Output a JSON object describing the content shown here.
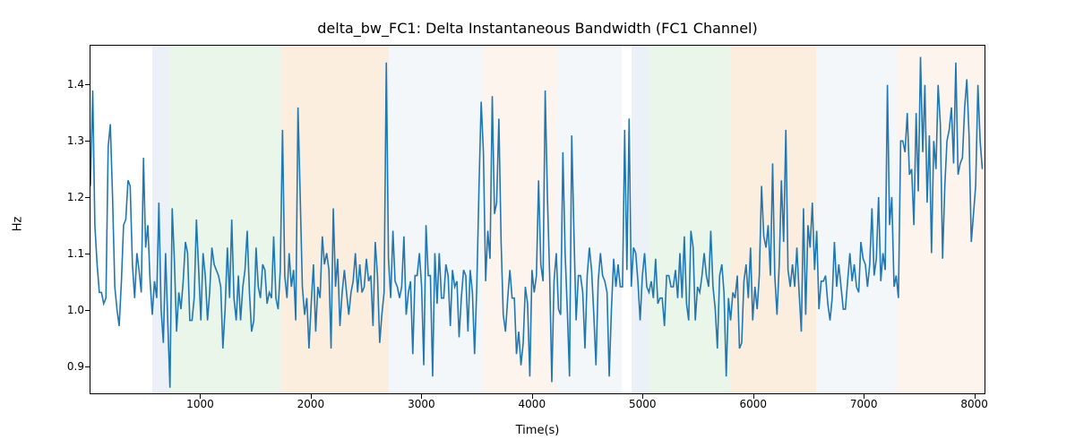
{
  "chart_data": {
    "type": "line",
    "title": "delta_bw_FC1: Delta Instantaneous Bandwidth (FC1 Channel)",
    "xlabel": "Time(s)",
    "ylabel": "Hz",
    "xlim": [
      0,
      8100
    ],
    "ylim": [
      0.85,
      1.47
    ],
    "xticks": [
      1000,
      2000,
      3000,
      4000,
      5000,
      6000,
      7000,
      8000
    ],
    "yticks": [
      0.9,
      1.0,
      1.1,
      1.2,
      1.3,
      1.4
    ],
    "line_color": "#1f77b4",
    "bands": [
      {
        "x0": 560,
        "x1": 720,
        "color": "blue"
      },
      {
        "x0": 720,
        "x1": 1720,
        "color": "green"
      },
      {
        "x0": 1720,
        "x1": 2700,
        "color": "orange"
      },
      {
        "x0": 2700,
        "x1": 3550,
        "color": "lblue"
      },
      {
        "x0": 3550,
        "x1": 4220,
        "color": "lorange"
      },
      {
        "x0": 4220,
        "x1": 4800,
        "color": "lblue"
      },
      {
        "x0": 4890,
        "x1": 5050,
        "color": "blue"
      },
      {
        "x0": 5050,
        "x1": 5780,
        "color": "green"
      },
      {
        "x0": 5780,
        "x1": 6560,
        "color": "orange"
      },
      {
        "x0": 6560,
        "x1": 7290,
        "color": "lblue"
      },
      {
        "x0": 7290,
        "x1": 8100,
        "color": "lorange"
      }
    ],
    "series": [
      {
        "name": "delta_bw_FC1",
        "x_step": 20,
        "values": [
          1.22,
          1.39,
          1.15,
          1.08,
          1.03,
          1.03,
          1.01,
          1.02,
          1.29,
          1.33,
          1.2,
          1.04,
          1.0,
          0.97,
          1.05,
          1.15,
          1.16,
          1.23,
          1.22,
          1.08,
          1.02,
          1.1,
          1.07,
          1.03,
          1.27,
          1.11,
          1.15,
          1.05,
          0.99,
          1.05,
          1.02,
          1.19,
          1.0,
          0.94,
          1.1,
          0.98,
          0.86,
          1.18,
          1.09,
          0.96,
          1.03,
          1.0,
          1.05,
          1.12,
          1.1,
          0.98,
          0.98,
          1.02,
          1.16,
          1.07,
          0.98,
          1.1,
          1.06,
          0.98,
          1.03,
          1.11,
          1.08,
          1.07,
          1.06,
          1.04,
          0.93,
          1.0,
          1.11,
          1.02,
          1.16,
          1.02,
          0.98,
          1.06,
          0.98,
          1.04,
          1.07,
          1.14,
          1.03,
          0.96,
          0.98,
          1.11,
          1.04,
          1.02,
          1.08,
          1.07,
          1.01,
          1.03,
          1.02,
          1.13,
          1.02,
          1.0,
          1.07,
          1.32,
          1.06,
          1.02,
          1.1,
          1.04,
          1.07,
          0.98,
          1.36,
          1.2,
          1.04,
          0.99,
          1.02,
          0.93,
          1.01,
          1.08,
          0.96,
          1.04,
          1.02,
          1.13,
          1.08,
          1.1,
          1.07,
          0.93,
          1.18,
          1.04,
          1.09,
          0.97,
          1.03,
          1.07,
          1.03,
          0.99,
          1.03,
          1.05,
          1.1,
          1.03,
          1.08,
          1.03,
          1.04,
          1.09,
          1.05,
          1.06,
          0.97,
          1.12,
          1.06,
          0.94,
          0.99,
          1.03,
          1.44,
          1.09,
          1.02,
          1.14,
          1.05,
          1.04,
          1.02,
          1.04,
          1.13,
          0.99,
          1.03,
          1.05,
          0.92,
          1.06,
          1.06,
          1.1,
          1.04,
          0.9,
          1.15,
          1.06,
          1.06,
          0.88,
          1.1,
          1.01,
          1.1,
          1.02,
          1.02,
          1.08,
          1.06,
          0.97,
          1.07,
          1.04,
          1.05,
          0.95,
          1.02,
          1.07,
          1.06,
          0.96,
          1.07,
          1.03,
          0.92,
          1.04,
          1.22,
          1.37,
          1.28,
          1.05,
          1.14,
          1.09,
          1.38,
          1.17,
          1.19,
          1.34,
          1.12,
          0.99,
          0.96,
          1.02,
          1.07,
          1.02,
          1.02,
          0.92,
          0.96,
          0.9,
          0.94,
          1.04,
          1.01,
          0.88,
          1.07,
          1.03,
          1.06,
          1.23,
          1.08,
          1.05,
          1.39,
          1.2,
          1.06,
          0.87,
          1.05,
          1.1,
          1.0,
          0.99,
          1.28,
          1.1,
          1.0,
          0.88,
          1.31,
          1.14,
          0.98,
          1.06,
          1.06,
          1.03,
          0.93,
          1.06,
          1.11,
          1.07,
          0.99,
          0.9,
          1.05,
          1.1,
          1.06,
          1.05,
          1.03,
          0.88,
          1.0,
          1.09,
          1.04,
          1.08,
          1.04,
          1.04,
          1.32,
          1.07,
          1.34,
          1.04,
          1.11,
          1.1,
          1.05,
          0.98,
          1.06,
          1.1,
          1.04,
          1.03,
          1.05,
          1.02,
          1.09,
          1.01,
          1.02,
          1.02,
          0.97,
          1.06,
          1.06,
          1.04,
          1.04,
          1.07,
          1.02,
          1.1,
          1.02,
          1.13,
          1.01,
          0.98,
          1.14,
          1.11,
          0.98,
          1.04,
          1.03,
          1.06,
          1.1,
          1.06,
          1.04,
          1.14,
          1.04,
          1.0,
          0.93,
          1.06,
          1.08,
          1.03,
          0.88,
          1.02,
          0.98,
          1.03,
          1.02,
          1.06,
          0.93,
          0.94,
          1.05,
          1.08,
          1.02,
          1.11,
          0.98,
          1.04,
          1.0,
          1.06,
          1.22,
          1.13,
          1.11,
          1.15,
          1.06,
          1.26,
          1.06,
          0.99,
          1.08,
          1.23,
          1.12,
          1.32,
          1.07,
          1.04,
          1.08,
          1.04,
          1.11,
          1.03,
          0.96,
          1.18,
          0.99,
          1.15,
          1.11,
          1.19,
          1.07,
          1.14,
          1.0,
          1.05,
          1.05,
          1.06,
          1.01,
          0.98,
          1.02,
          1.12,
          1.04,
          1.08,
          1.04,
          1.0,
          1.0,
          1.05,
          1.1,
          1.05,
          1.08,
          1.04,
          1.03,
          1.12,
          1.09,
          1.08,
          1.04,
          1.08,
          1.18,
          1.06,
          1.09,
          1.2,
          1.05,
          1.1,
          1.07,
          1.4,
          1.15,
          1.2,
          1.04,
          1.06,
          1.02,
          1.3,
          1.3,
          1.28,
          1.35,
          1.24,
          1.25,
          1.15,
          1.35,
          1.21,
          1.45,
          1.28,
          1.4,
          1.19,
          1.31,
          1.1,
          1.3,
          1.25,
          1.4,
          1.33,
          1.09,
          1.22,
          1.3,
          1.32,
          1.36,
          1.26,
          1.44,
          1.24,
          1.26,
          1.27,
          1.36,
          1.41,
          1.31,
          1.12,
          1.17,
          1.22,
          1.4,
          1.3,
          1.25
        ]
      }
    ]
  }
}
